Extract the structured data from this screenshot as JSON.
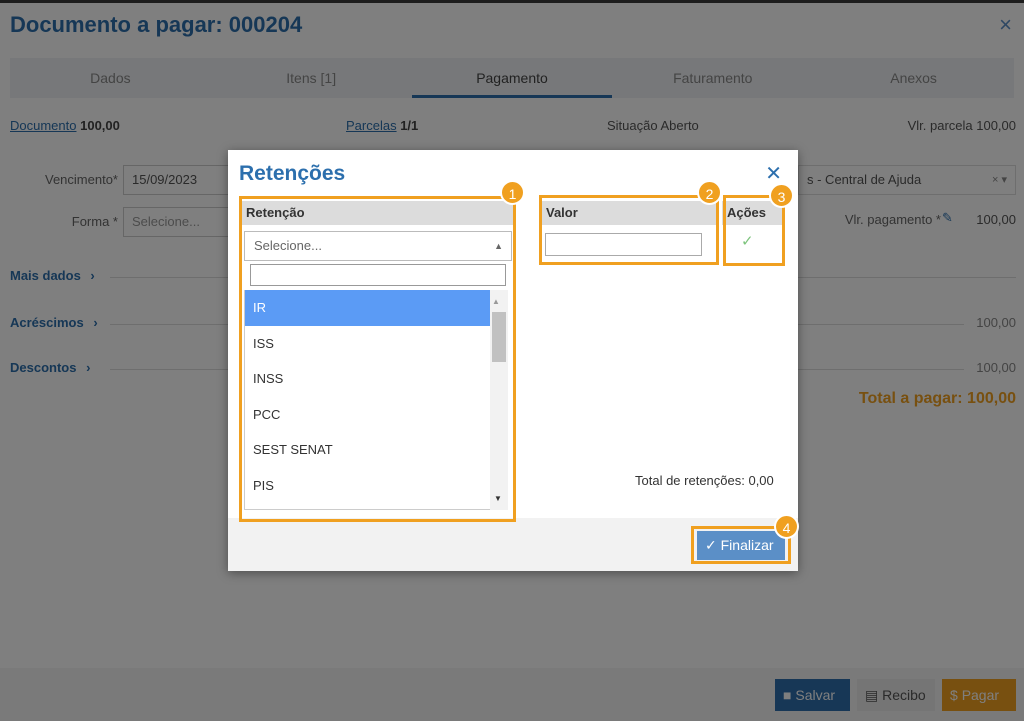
{
  "page": {
    "title": "Documento a pagar: 000204",
    "close_icon": "×",
    "tabs": [
      "Dados",
      "Itens [1]",
      "Pagamento",
      "Faturamento",
      "Anexos"
    ],
    "active_tab": "Pagamento",
    "documento_link": "Documento",
    "documento_value": "100,00",
    "parcelas_link": "Parcelas",
    "parcelas_value": "1/1",
    "situacao": "Situação Aberto",
    "vlr_parcela": "Vlr. parcela 100,00",
    "vencimento_label": "Vencimento*",
    "vencimento_value": "15/09/2023",
    "forma_label": "Forma *",
    "forma_placeholder": "Selecione...",
    "conta_value": "s - Central de Ajuda",
    "conta_clear": "× ▾",
    "vlr_pagamento_label": "Vlr. pagamento *",
    "vlr_pagamento_value": "100,00",
    "mais_dados": "Mais dados",
    "acrescimos": "Acréscimos",
    "acrescimos_value": "100,00",
    "descontos": "Descontos",
    "descontos_value": "100,00",
    "section_chevron": "›",
    "total_pagar": "Total a pagar: 100,00",
    "btn_salvar": "Salvar",
    "btn_recibo": "Recibo",
    "btn_pagar": "Pagar"
  },
  "modal": {
    "title": "Retenções",
    "close_icon": "✕",
    "col_retencao": "Retenção",
    "col_valor": "Valor",
    "col_acoes": "Ações",
    "select_placeholder": "Selecione...",
    "options": [
      "IR",
      "ISS",
      "INSS",
      "PCC",
      "SEST SENAT",
      "PIS"
    ],
    "selected_option": "IR",
    "total_retencoes": "Total de retenções: 0,00",
    "finalizar": "Finalizar",
    "check_icon": "✓",
    "badges": [
      "1",
      "2",
      "3",
      "4"
    ]
  },
  "colors": {
    "accent": "#2c6fad",
    "highlight": "#f0a020",
    "selected_option": "#5b9bf5"
  }
}
